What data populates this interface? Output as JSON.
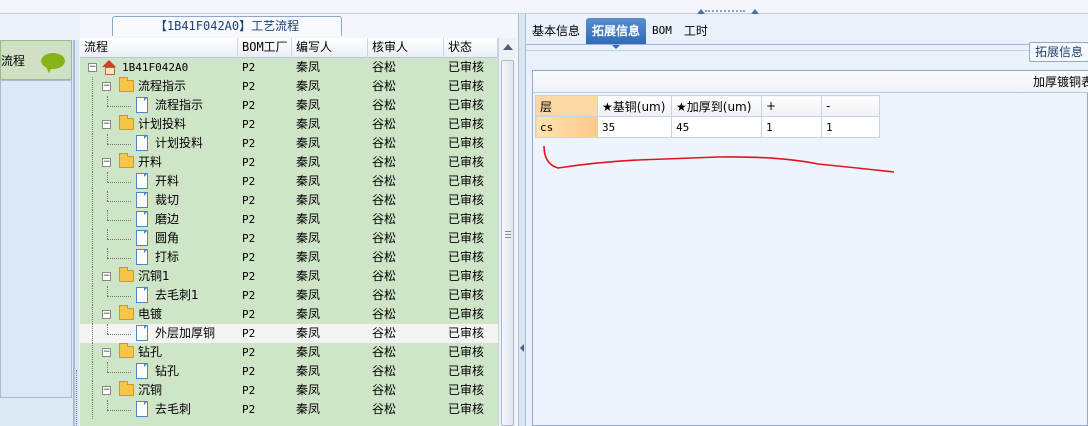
{
  "left_nav": {
    "item_label": "流程"
  },
  "grid": {
    "title": "【1B41F042A0】工艺流程",
    "columns": [
      "流程",
      "BOM工厂",
      "编写人",
      "核审人",
      "状态"
    ],
    "rows": [
      {
        "level": 0,
        "kind": "root",
        "name": "1B41F042A0",
        "bom": "P2",
        "writer": "秦凤",
        "reviewer": "谷松",
        "status": "已审核"
      },
      {
        "level": 1,
        "kind": "folder",
        "name": "流程指示",
        "bom": "P2",
        "writer": "秦凤",
        "reviewer": "谷松",
        "status": "已审核"
      },
      {
        "level": 2,
        "kind": "doc",
        "name": "流程指示",
        "bom": "P2",
        "writer": "秦凤",
        "reviewer": "谷松",
        "status": "已审核"
      },
      {
        "level": 1,
        "kind": "folder",
        "name": "计划投料",
        "bom": "P2",
        "writer": "秦凤",
        "reviewer": "谷松",
        "status": "已审核"
      },
      {
        "level": 2,
        "kind": "doc",
        "name": "计划投料",
        "bom": "P2",
        "writer": "秦凤",
        "reviewer": "谷松",
        "status": "已审核"
      },
      {
        "level": 1,
        "kind": "folder",
        "name": "开料",
        "bom": "P2",
        "writer": "秦凤",
        "reviewer": "谷松",
        "status": "已审核"
      },
      {
        "level": 2,
        "kind": "doc",
        "name": "开料",
        "bom": "P2",
        "writer": "秦凤",
        "reviewer": "谷松",
        "status": "已审核"
      },
      {
        "level": 2,
        "kind": "doc",
        "name": "裁切",
        "bom": "P2",
        "writer": "秦凤",
        "reviewer": "谷松",
        "status": "已审核"
      },
      {
        "level": 2,
        "kind": "doc",
        "name": "磨边",
        "bom": "P2",
        "writer": "秦凤",
        "reviewer": "谷松",
        "status": "已审核"
      },
      {
        "level": 2,
        "kind": "doc",
        "name": "圆角",
        "bom": "P2",
        "writer": "秦凤",
        "reviewer": "谷松",
        "status": "已审核"
      },
      {
        "level": 2,
        "kind": "doc",
        "name": "打标",
        "bom": "P2",
        "writer": "秦凤",
        "reviewer": "谷松",
        "status": "已审核"
      },
      {
        "level": 1,
        "kind": "folder",
        "name": "沉铜1",
        "bom": "P2",
        "writer": "秦凤",
        "reviewer": "谷松",
        "status": "已审核"
      },
      {
        "level": 2,
        "kind": "doc",
        "name": "去毛刺1",
        "bom": "P2",
        "writer": "秦凤",
        "reviewer": "谷松",
        "status": "已审核"
      },
      {
        "level": 1,
        "kind": "folder",
        "name": "电镀",
        "bom": "P2",
        "writer": "秦凤",
        "reviewer": "谷松",
        "status": "已审核"
      },
      {
        "level": 2,
        "kind": "doc",
        "name": "外层加厚铜",
        "bom": "P2",
        "writer": "秦凤",
        "reviewer": "谷松",
        "status": "已审核",
        "selected": true
      },
      {
        "level": 1,
        "kind": "folder",
        "name": "钻孔",
        "bom": "P2",
        "writer": "秦凤",
        "reviewer": "谷松",
        "status": "已审核"
      },
      {
        "level": 2,
        "kind": "doc",
        "name": "钻孔",
        "bom": "P2",
        "writer": "秦凤",
        "reviewer": "谷松",
        "status": "已审核"
      },
      {
        "level": 1,
        "kind": "folder",
        "name": "沉铜",
        "bom": "P2",
        "writer": "秦凤",
        "reviewer": "谷松",
        "status": "已审核"
      },
      {
        "level": 2,
        "kind": "doc",
        "name": "去毛刺",
        "bom": "P2",
        "writer": "秦凤",
        "reviewer": "谷松",
        "status": "已审核"
      }
    ]
  },
  "right": {
    "tabs": [
      "基本信息",
      "拓展信息",
      "BOM",
      "工时"
    ],
    "active_tab": "拓展信息",
    "ext_button": "拓展信息",
    "table_caption": "加厚镀铜表",
    "table_headers": [
      "层",
      "★基铜(um)",
      "★加厚到(um)",
      "+",
      "-"
    ],
    "table_rows": [
      [
        "cs",
        "35",
        "45",
        "1",
        "1"
      ]
    ]
  },
  "colors": {
    "tree_bg": "#cfe5c8",
    "active_tab": "#3b78c2",
    "annotation": "#e0141e"
  }
}
